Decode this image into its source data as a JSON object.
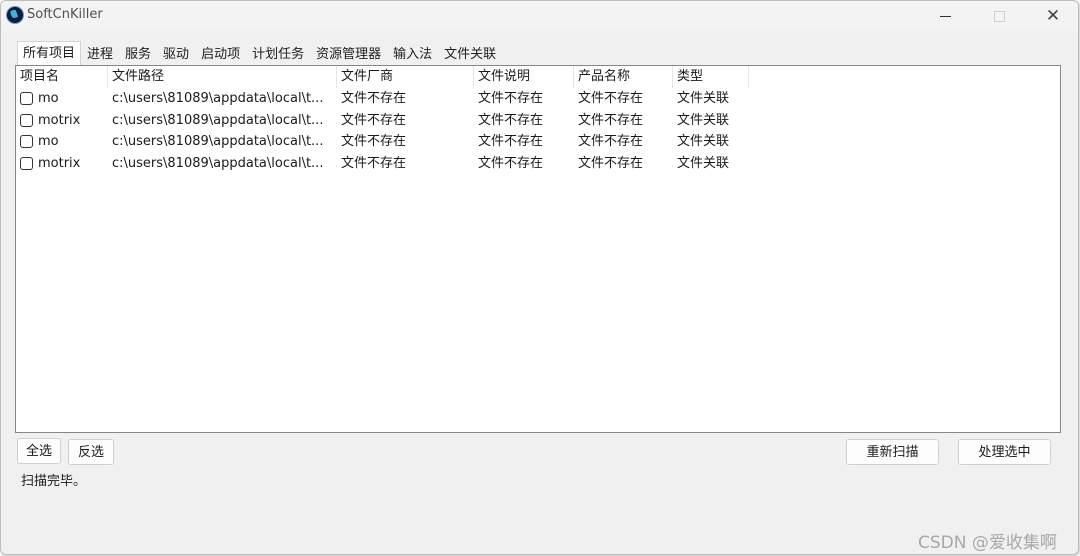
{
  "window": {
    "title": "SoftCnKiller",
    "controls": {
      "minimize_icon": "minimize-icon",
      "maximize_icon": "maximize-icon",
      "close_glyph": "✕"
    }
  },
  "tabs": [
    {
      "label": "所有项目",
      "active": true
    },
    {
      "label": "进程",
      "active": false
    },
    {
      "label": "服务",
      "active": false
    },
    {
      "label": "驱动",
      "active": false
    },
    {
      "label": "启动项",
      "active": false
    },
    {
      "label": "计划任务",
      "active": false
    },
    {
      "label": "资源管理器",
      "active": false
    },
    {
      "label": "输入法",
      "active": false
    },
    {
      "label": "文件关联",
      "active": false
    }
  ],
  "table": {
    "columns": [
      "项目名",
      "文件路径",
      "文件厂商",
      "文件说明",
      "产品名称",
      "类型"
    ],
    "rows": [
      {
        "checked": false,
        "name": "mo",
        "path": "c:\\users\\81089\\appdata\\local\\t...",
        "vendor": "文件不存在",
        "description": "文件不存在",
        "product": "文件不存在",
        "type": "文件关联"
      },
      {
        "checked": false,
        "name": "motrix",
        "path": "c:\\users\\81089\\appdata\\local\\t...",
        "vendor": "文件不存在",
        "description": "文件不存在",
        "product": "文件不存在",
        "type": "文件关联"
      },
      {
        "checked": false,
        "name": "mo",
        "path": "c:\\users\\81089\\appdata\\local\\t...",
        "vendor": "文件不存在",
        "description": "文件不存在",
        "product": "文件不存在",
        "type": "文件关联"
      },
      {
        "checked": false,
        "name": "motrix",
        "path": "c:\\users\\81089\\appdata\\local\\t...",
        "vendor": "文件不存在",
        "description": "文件不存在",
        "product": "文件不存在",
        "type": "文件关联"
      }
    ]
  },
  "buttons": {
    "select_all": "全选",
    "invert": "反选",
    "rescan": "重新扫描",
    "process_selected": "处理选中"
  },
  "status": "扫描完毕。",
  "watermark": "CSDN @爱收集啊"
}
